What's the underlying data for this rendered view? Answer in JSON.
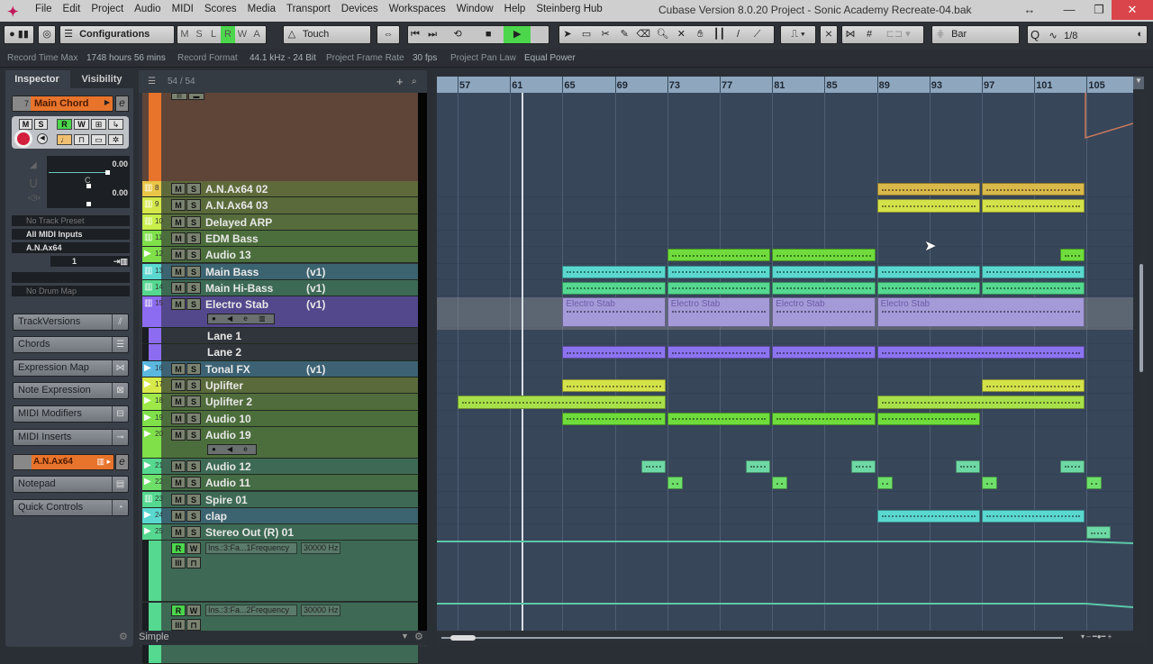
{
  "window": {
    "title": "Cubase Version 8.0.20 Project - Sonic Academy Recreate-04.bak",
    "menu": [
      "File",
      "Edit",
      "Project",
      "Audio",
      "MIDI",
      "Scores",
      "Media",
      "Transport",
      "Devices",
      "Workspaces",
      "Window",
      "Help",
      "Steinberg Hub"
    ],
    "controls": {
      "resize": "↔",
      "minimize": "—",
      "maximize": "❐",
      "close": "✕"
    }
  },
  "toolbar": {
    "configurations": "Configurations",
    "automation_buttons": [
      "M",
      "S",
      "L",
      "R",
      "W",
      "A"
    ],
    "automation_active": "R",
    "automation_mode": "Touch",
    "snap_type": "Bar",
    "quantize": "1/8",
    "quantize_label": "Q"
  },
  "status": {
    "record_time_label": "Record Time Max",
    "record_time_value": "1748 hours 56 mins",
    "record_format_label": "Record Format",
    "record_format_value": "44.1 kHz - 24 Bit",
    "frame_rate_label": "Project Frame Rate",
    "frame_rate_value": "30 fps",
    "pan_law_label": "Project Pan Law",
    "pan_law_value": "Equal Power"
  },
  "inspector": {
    "tabs": [
      "Inspector",
      "Visibility"
    ],
    "track_number": "7",
    "track_name": "Main Chord",
    "volume": "0.00",
    "pan_label": "C",
    "delay": "0.00",
    "track_preset": "No Track Preset",
    "midi_input": "All MIDI Inputs",
    "midi_output": "A.N.Ax64",
    "channel": "1",
    "drum_map": "No Drum Map",
    "sections": [
      "TrackVersions",
      "Chords",
      "Expression Map",
      "Note Expression",
      "MIDI Modifiers",
      "MIDI Inserts"
    ],
    "instrument": "A.N.Ax64",
    "sections2": [
      "Notepad",
      "Quick Controls"
    ]
  },
  "tracklist": {
    "count": "54 / 54",
    "footer": "Simple",
    "tracks": [
      {
        "num": "8",
        "name": "A.N.Ax64 02",
        "version": "",
        "color": "#e8c547",
        "bg": "#5f6a3a",
        "type": "midi"
      },
      {
        "num": "9",
        "name": "A.N.Ax64 03",
        "version": "",
        "color": "#d4e84a",
        "bg": "#5a6a3a",
        "type": "midi"
      },
      {
        "num": "10",
        "name": "Delayed ARP",
        "version": "",
        "color": "#c8ee4a",
        "bg": "#566c3c",
        "type": "midi"
      },
      {
        "num": "11",
        "name": "EDM Bass",
        "version": "",
        "color": "#7fe04a",
        "bg": "#4c6e3c",
        "type": "midi"
      },
      {
        "num": "12",
        "name": "Audio 13",
        "version": "",
        "color": "#7fe04a",
        "bg": "#4c6e3c",
        "type": "audio"
      },
      {
        "num": "13",
        "name": "Main Bass",
        "version": "(v1)",
        "color": "#5ad8d0",
        "bg": "#3c6470",
        "type": "midi"
      },
      {
        "num": "14",
        "name": "Main Hi-Bass",
        "version": "(v1)",
        "color": "#55d890",
        "bg": "#3c6a55",
        "type": "midi"
      },
      {
        "num": "15",
        "name": "Electro Stab",
        "version": "(v1)",
        "color": "#8c6cf0",
        "bg": "#54488c",
        "type": "midi"
      },
      {
        "num": "",
        "name": "Lane 1",
        "version": "",
        "color": "#8c6cf0",
        "bg": "#30353b",
        "type": "lane"
      },
      {
        "num": "",
        "name": "Lane 2",
        "version": "",
        "color": "#8c6cf0",
        "bg": "#30353b",
        "type": "lane"
      },
      {
        "num": "16",
        "name": "Tonal FX",
        "version": "(v1)",
        "color": "#5ab8e0",
        "bg": "#3c6274",
        "type": "audio"
      },
      {
        "num": "17",
        "name": "Uplifter",
        "version": "",
        "color": "#d8ea4a",
        "bg": "#5a6a3a",
        "type": "audio"
      },
      {
        "num": "18",
        "name": "Uplifter 2",
        "version": "",
        "color": "#9ee84a",
        "bg": "#506c3c",
        "type": "audio"
      },
      {
        "num": "19",
        "name": "Audio 10",
        "version": "",
        "color": "#7fe04a",
        "bg": "#4c6e3c",
        "type": "audio"
      },
      {
        "num": "20",
        "name": "Audio 19",
        "version": "",
        "color": "#7fe04a",
        "bg": "#4c6e3c",
        "type": "audio"
      },
      {
        "num": "21",
        "name": "Audio 12",
        "version": "",
        "color": "#55d890",
        "bg": "#3e6a55",
        "type": "audio"
      },
      {
        "num": "22",
        "name": "Audio 11",
        "version": "",
        "color": "#6ee06a",
        "bg": "#456c45",
        "type": "audio"
      },
      {
        "num": "23",
        "name": "Spire 01",
        "version": "",
        "color": "#55d890",
        "bg": "#3e6a55",
        "type": "midi"
      },
      {
        "num": "24",
        "name": "clap",
        "version": "",
        "color": "#5ad8d0",
        "bg": "#3c6470",
        "type": "audio"
      },
      {
        "num": "25",
        "name": "Stereo Out (R) 01",
        "version": "",
        "color": "#55d890",
        "bg": "#3e6a55",
        "type": "audio"
      }
    ],
    "automation": [
      {
        "param": "Ins.:3:Fa...1Frequency",
        "value": "30000 Hz"
      },
      {
        "param": "Ins.:3:Fa...2Frequency",
        "value": "30000 Hz"
      }
    ]
  },
  "ruler": {
    "bars": [
      "57",
      "61",
      "65",
      "69",
      "73",
      "77",
      "81",
      "85",
      "89",
      "93",
      "97",
      "101",
      "105"
    ]
  },
  "events": [
    {
      "track": "A.N.Ax64 02",
      "start": 89,
      "end": 97,
      "color": "#d9b94a",
      "label": ""
    },
    {
      "track": "A.N.Ax64 02",
      "start": 97,
      "end": 105,
      "color": "#d9b94a",
      "label": ""
    },
    {
      "track": "A.N.Ax64 03",
      "start": 89,
      "end": 97,
      "color": "#d4e24a",
      "label": ""
    },
    {
      "track": "A.N.Ax64 03",
      "start": 97,
      "end": 105,
      "color": "#d4e24a",
      "label": ""
    },
    {
      "track": "Audio 13",
      "start": 73,
      "end": 81,
      "color": "#6fdc3c",
      "label": ""
    },
    {
      "track": "Audio 13",
      "start": 81,
      "end": 89,
      "color": "#6fdc3c",
      "label": ""
    },
    {
      "track": "Audio 13",
      "start": 103,
      "end": 105,
      "color": "#6fdc3c",
      "label": ""
    },
    {
      "track": "Main Bass",
      "start": 65,
      "end": 73,
      "color": "#5ad8d0",
      "label": ""
    },
    {
      "track": "Main Bass",
      "start": 73,
      "end": 81,
      "color": "#5ad8d0",
      "label": ""
    },
    {
      "track": "Main Bass",
      "start": 81,
      "end": 89,
      "color": "#5ad8d0",
      "label": ""
    },
    {
      "track": "Main Bass",
      "start": 89,
      "end": 97,
      "color": "#5ad8d0",
      "label": ""
    },
    {
      "track": "Main Bass",
      "start": 97,
      "end": 105,
      "color": "#5ad8d0",
      "label": ""
    },
    {
      "track": "Main Hi-Bass",
      "start": 65,
      "end": 73,
      "color": "#55d890",
      "label": ""
    },
    {
      "track": "Main Hi-Bass",
      "start": 73,
      "end": 81,
      "color": "#55d890",
      "label": ""
    },
    {
      "track": "Main Hi-Bass",
      "start": 81,
      "end": 89,
      "color": "#55d890",
      "label": ""
    },
    {
      "track": "Main Hi-Bass",
      "start": 89,
      "end": 97,
      "color": "#55d890",
      "label": ""
    },
    {
      "track": "Main Hi-Bass",
      "start": 97,
      "end": 105,
      "color": "#55d890",
      "label": ""
    },
    {
      "track": "Electro Stab",
      "start": 65,
      "end": 73,
      "color": "#a49ad8",
      "label": "Electro Stab"
    },
    {
      "track": "Electro Stab",
      "start": 73,
      "end": 81,
      "color": "#a49ad8",
      "label": "Electro Stab"
    },
    {
      "track": "Electro Stab",
      "start": 81,
      "end": 89,
      "color": "#a49ad8",
      "label": "Electro Stab"
    },
    {
      "track": "Electro Stab",
      "start": 89,
      "end": 105,
      "color": "#a49ad8",
      "label": "Electro Stab"
    },
    {
      "track": "Lane 1",
      "start": 65,
      "end": 73,
      "color": "#8c74f0",
      "label": ""
    },
    {
      "track": "Lane 1",
      "start": 73,
      "end": 81,
      "color": "#8c74f0",
      "label": ""
    },
    {
      "track": "Lane 1",
      "start": 81,
      "end": 89,
      "color": "#8c74f0",
      "label": ""
    },
    {
      "track": "Lane 1",
      "start": 89,
      "end": 105,
      "color": "#8c74f0",
      "label": ""
    },
    {
      "track": "Uplifter",
      "start": 65,
      "end": 73,
      "color": "#d4e24a",
      "label": ""
    },
    {
      "track": "Uplifter",
      "start": 97,
      "end": 105,
      "color": "#d4e24a",
      "label": ""
    },
    {
      "track": "Uplifter 2",
      "start": 57,
      "end": 73,
      "color": "#a8e04a",
      "label": ""
    },
    {
      "track": "Uplifter 2",
      "start": 89,
      "end": 105,
      "color": "#a8e04a",
      "label": ""
    },
    {
      "track": "Audio 10",
      "start": 65,
      "end": 73,
      "color": "#6fdc3c",
      "label": ""
    },
    {
      "track": "Audio 10",
      "start": 73,
      "end": 81,
      "color": "#6fdc3c",
      "label": ""
    },
    {
      "track": "Audio 10",
      "start": 81,
      "end": 89,
      "color": "#6fdc3c",
      "label": ""
    },
    {
      "track": "Audio 10",
      "start": 89,
      "end": 97,
      "color": "#6fdc3c",
      "label": ""
    },
    {
      "track": "Audio 12",
      "start": 71,
      "end": 73,
      "color": "#6ed8a4",
      "label": ""
    },
    {
      "track": "Audio 12",
      "start": 79,
      "end": 81,
      "color": "#6ed8a4",
      "label": ""
    },
    {
      "track": "Audio 12",
      "start": 87,
      "end": 89,
      "color": "#6ed8a4",
      "label": ""
    },
    {
      "track": "Audio 12",
      "start": 95,
      "end": 97,
      "color": "#6ed8a4",
      "label": ""
    },
    {
      "track": "Audio 12",
      "start": 103,
      "end": 105,
      "color": "#6ed8a4",
      "label": ""
    },
    {
      "track": "Audio 11",
      "start": 73,
      "end": 74.3,
      "color": "#6ee06a",
      "label": ""
    },
    {
      "track": "Audio 11",
      "start": 81,
      "end": 82.3,
      "color": "#6ee06a",
      "label": ""
    },
    {
      "track": "Audio 11",
      "start": 89,
      "end": 90.3,
      "color": "#6ee06a",
      "label": ""
    },
    {
      "track": "Audio 11",
      "start": 97,
      "end": 98.3,
      "color": "#6ee06a",
      "label": ""
    },
    {
      "track": "Audio 11",
      "start": 105,
      "end": 106.3,
      "color": "#6ee06a",
      "label": ""
    },
    {
      "track": "clap",
      "start": 89,
      "end": 97,
      "color": "#5ad8d0",
      "label": ""
    },
    {
      "track": "clap",
      "start": 97,
      "end": 105,
      "color": "#5ad8d0",
      "label": ""
    },
    {
      "track": "Stereo Out (R) 01",
      "start": 105,
      "end": 107,
      "color": "#6ed8a4",
      "label": ""
    }
  ],
  "colors": {
    "accent_orange": "#e8742c",
    "play_green": "#4cd64c",
    "close_red": "#d9454a"
  }
}
